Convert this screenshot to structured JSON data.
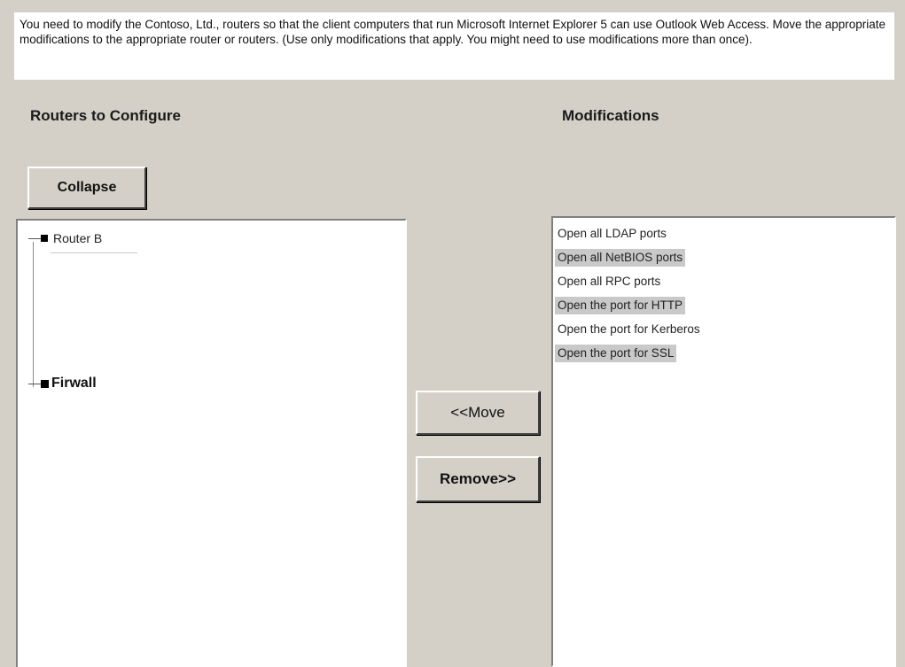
{
  "instructions": "You need to modify the Contoso, Ltd., routers so that the client computers that run Microsoft Internet Explorer 5 can use Outlook Web Access. Move the appropriate modifications to the appropriate router or routers. (Use only modifications that apply. You might need to use modifications more than once).",
  "left": {
    "title": "Routers to Configure",
    "collapse_label": "Collapse",
    "tree": [
      {
        "label": "Router B",
        "icon": "square-node-icon"
      },
      {
        "label": "Firwall",
        "icon": "square-node-icon"
      }
    ]
  },
  "right": {
    "title": "Modifications",
    "items": [
      {
        "label": "Open all LDAP ports",
        "shaded": false
      },
      {
        "label": "Open all NetBIOS ports",
        "shaded": true
      },
      {
        "label": "Open all RPC ports",
        "shaded": false
      },
      {
        "label": "Open the port for HTTP",
        "shaded": true
      },
      {
        "label": "Open the port for Kerberos",
        "shaded": false
      },
      {
        "label": "Open the port for SSL",
        "shaded": true
      }
    ]
  },
  "buttons": {
    "move_label": "<<Move",
    "remove_label": "Remove>>"
  },
  "colors": {
    "background": "#d4d0c8",
    "panel": "#ffffff",
    "shaded_item": "#c9c9c9"
  }
}
